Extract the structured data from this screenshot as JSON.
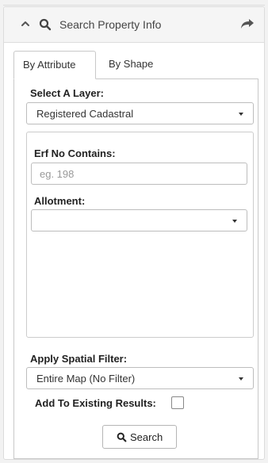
{
  "header": {
    "title": "Search Property Info",
    "collapse_icon": "chevron-up-icon",
    "search_icon": "search-icon",
    "share_icon": "share-icon"
  },
  "tabs": [
    {
      "label": "By Attribute",
      "active": true
    },
    {
      "label": "By Shape",
      "active": false
    }
  ],
  "form": {
    "layer_label": "Select A Layer:",
    "layer_value": "Registered Cadastral",
    "erf_label": "Erf No Contains:",
    "erf_placeholder": "eg. 198",
    "erf_value": "",
    "allotment_label": "Allotment:",
    "allotment_value": "",
    "spatial_label": "Apply Spatial Filter:",
    "spatial_value": "Entire Map (No Filter)",
    "add_existing_label": "Add To Existing Results:",
    "add_existing_checked": false,
    "search_button": "Search"
  },
  "colors": {
    "header_bg": "#f5f5f5",
    "border": "#c8c8c8",
    "icon": "#555555"
  }
}
